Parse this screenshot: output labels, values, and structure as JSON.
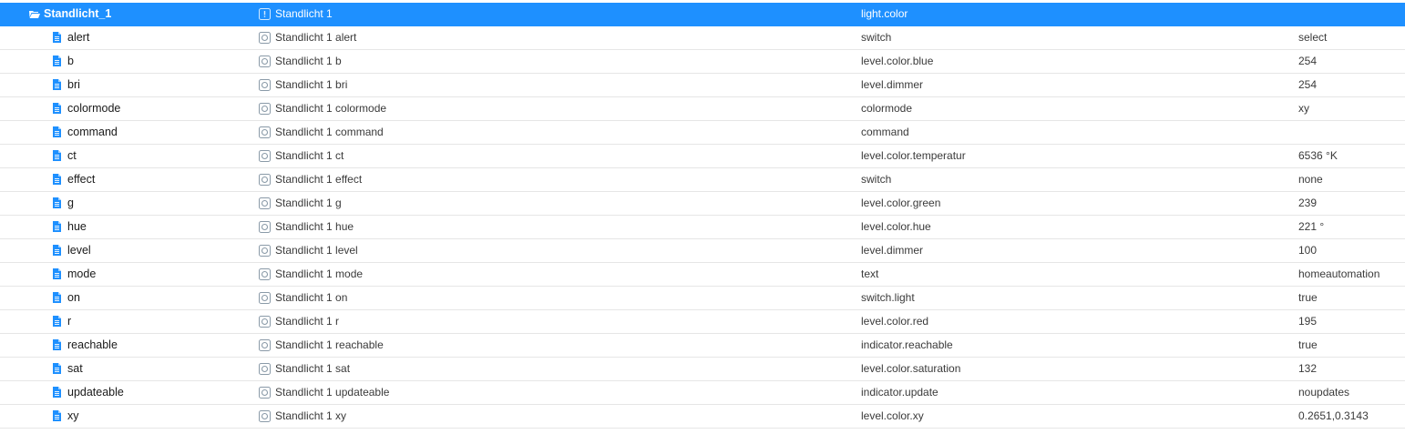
{
  "tree": {
    "parent": {
      "id": "Standlicht_1",
      "name": "Standlicht 1",
      "role": "light.color",
      "value": "",
      "icon": "folder-open-icon",
      "selected": true
    },
    "children": [
      {
        "id": "alert",
        "name": "Standlicht 1 alert",
        "role": "switch",
        "value": "select"
      },
      {
        "id": "b",
        "name": "Standlicht 1 b",
        "role": "level.color.blue",
        "value": "254"
      },
      {
        "id": "bri",
        "name": "Standlicht 1 bri",
        "role": "level.dimmer",
        "value": "254"
      },
      {
        "id": "colormode",
        "name": "Standlicht 1 colormode",
        "role": "colormode",
        "value": "xy"
      },
      {
        "id": "command",
        "name": "Standlicht 1 command",
        "role": "command",
        "value": ""
      },
      {
        "id": "ct",
        "name": "Standlicht 1 ct",
        "role": "level.color.temperatur",
        "value": "6536 °K"
      },
      {
        "id": "effect",
        "name": "Standlicht 1 effect",
        "role": "switch",
        "value": "none"
      },
      {
        "id": "g",
        "name": "Standlicht 1 g",
        "role": "level.color.green",
        "value": "239"
      },
      {
        "id": "hue",
        "name": "Standlicht 1 hue",
        "role": "level.color.hue",
        "value": "221 °"
      },
      {
        "id": "level",
        "name": "Standlicht 1 level",
        "role": "level.dimmer",
        "value": "100"
      },
      {
        "id": "mode",
        "name": "Standlicht 1 mode",
        "role": "text",
        "value": "homeautomation"
      },
      {
        "id": "on",
        "name": "Standlicht 1 on",
        "role": "switch.light",
        "value": "true"
      },
      {
        "id": "r",
        "name": "Standlicht 1 r",
        "role": "level.color.red",
        "value": "195"
      },
      {
        "id": "reachable",
        "name": "Standlicht 1 reachable",
        "role": "indicator.reachable",
        "value": "true"
      },
      {
        "id": "sat",
        "name": "Standlicht 1 sat",
        "role": "level.color.saturation",
        "value": "132"
      },
      {
        "id": "updateable",
        "name": "Standlicht 1 updateable",
        "role": "indicator.update",
        "value": "noupdates"
      },
      {
        "id": "xy",
        "name": "Standlicht 1 xy",
        "role": "level.color.xy",
        "value": "0.2651,0.3143"
      }
    ]
  },
  "icons": {
    "child_icon": "file-icon",
    "name_icon": "state-icon",
    "parent_name_icon": "channel-icon"
  },
  "colors": {
    "selection_bg": "#1e90ff",
    "icon_blue": "#1e90ff",
    "state_icon_gray": "#8a9aa8"
  }
}
